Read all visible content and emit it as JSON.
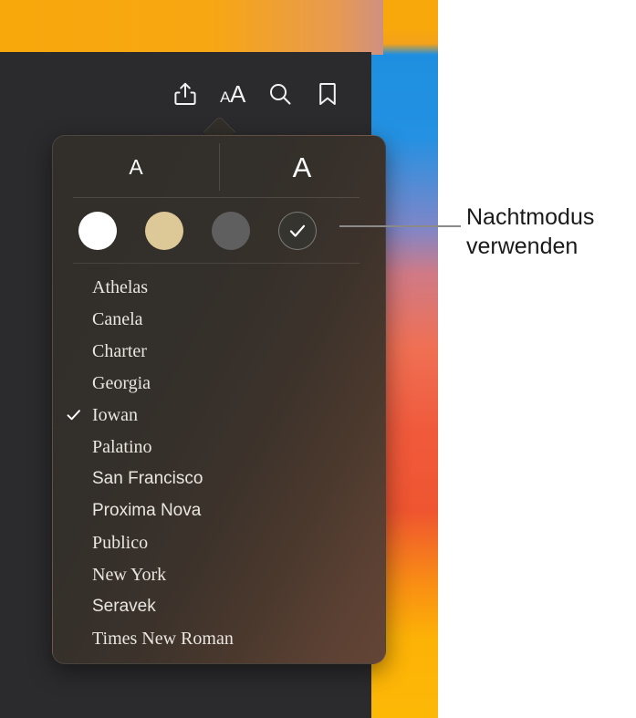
{
  "window": {
    "toolbar": {
      "buttons": [
        {
          "name": "share-icon",
          "label": "Teilen"
        },
        {
          "name": "text-size-icon",
          "label": "aA"
        },
        {
          "name": "search-icon",
          "label": "Suchen"
        },
        {
          "name": "bookmark-icon",
          "label": "Lesezeichen"
        }
      ]
    }
  },
  "popover": {
    "size_controls": {
      "decrease_label": "A",
      "increase_label": "A"
    },
    "themes": [
      {
        "name": "theme-white",
        "label": "Weiß",
        "color": "#ffffff",
        "selected": false
      },
      {
        "name": "theme-sepia",
        "label": "Sepia",
        "color": "#ddc897",
        "selected": false
      },
      {
        "name": "theme-gray",
        "label": "Grau",
        "color": "#605f60",
        "selected": false
      },
      {
        "name": "theme-night",
        "label": "Nachtmodus",
        "color": "#36342f",
        "selected": true
      }
    ],
    "fonts": [
      {
        "label": "Athelas",
        "style": "serif",
        "selected": false
      },
      {
        "label": "Canela",
        "style": "serif",
        "selected": false
      },
      {
        "label": "Charter",
        "style": "serif",
        "selected": false
      },
      {
        "label": "Georgia",
        "style": "serif",
        "selected": false
      },
      {
        "label": "Iowan",
        "style": "serif",
        "selected": true
      },
      {
        "label": "Palatino",
        "style": "serif",
        "selected": false
      },
      {
        "label": "San Francisco",
        "style": "sans",
        "selected": false
      },
      {
        "label": "Proxima Nova",
        "style": "sans",
        "selected": false
      },
      {
        "label": "Publico",
        "style": "serif",
        "selected": false
      },
      {
        "label": "New York",
        "style": "serif",
        "selected": false
      },
      {
        "label": "Seravek",
        "style": "sans",
        "selected": false
      },
      {
        "label": "Times New Roman",
        "style": "serif",
        "selected": false
      }
    ]
  },
  "callout": {
    "text": "Nachtmodus verwenden"
  },
  "colors": {
    "window_background": "#2b2b2d",
    "popover_background": "#322e29",
    "text": "#e9e6e0",
    "callout_text": "#1a1a1a",
    "callout_line": "#8a8a8a"
  }
}
